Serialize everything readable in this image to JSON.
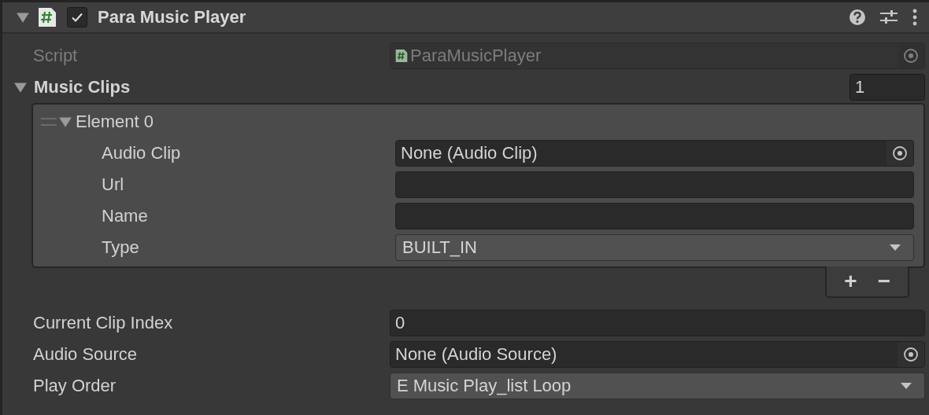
{
  "component": {
    "title": "Para Music Player",
    "expanded": true,
    "enabled": true
  },
  "script": {
    "label": "Script",
    "value": "ParaMusicPlayer",
    "disabled": true
  },
  "music_clips": {
    "label": "Music Clips",
    "expanded": true,
    "size": "1",
    "add": "+",
    "remove": "−",
    "elements": [
      {
        "label": "Element 0",
        "expanded": true,
        "fields": [
          {
            "label": "Audio Clip",
            "kind": "object",
            "value": "None (Audio Clip)"
          },
          {
            "label": "Url",
            "kind": "text"
          },
          {
            "label": "Name",
            "kind": "text"
          },
          {
            "label": "Type",
            "kind": "enum",
            "value": "BUILT_IN"
          }
        ]
      }
    ]
  },
  "fields": [
    {
      "label": "Current Clip Index",
      "kind": "int",
      "value": "0"
    },
    {
      "label": "Audio Source",
      "kind": "object",
      "value": "None (Audio Source)"
    },
    {
      "label": "Play Order",
      "kind": "enum",
      "value": "E Music Play_list Loop"
    }
  ]
}
